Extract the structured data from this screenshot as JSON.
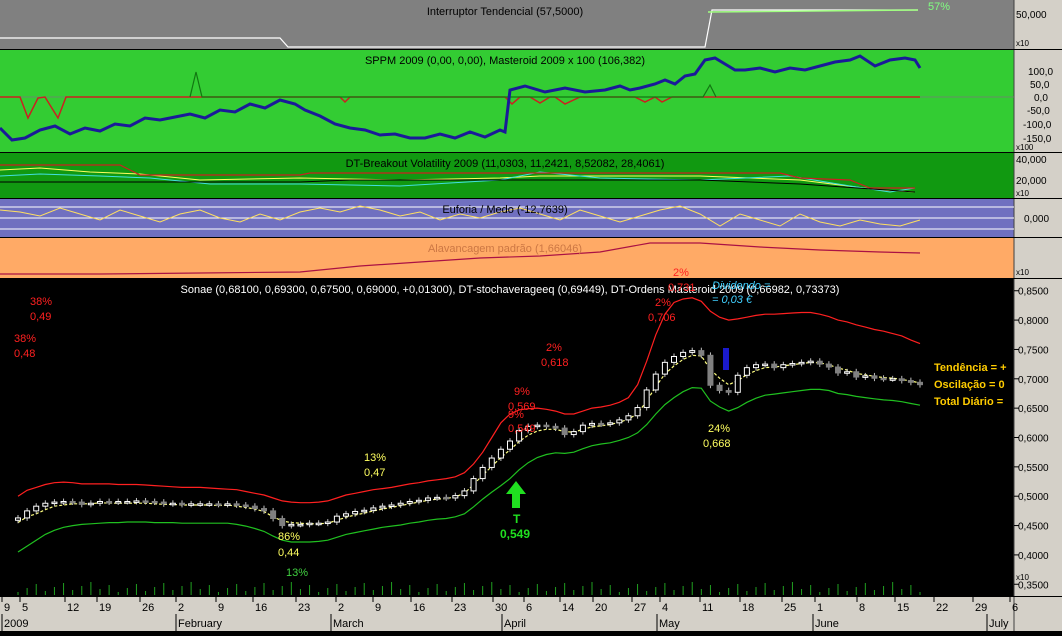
{
  "panels": {
    "switch": {
      "title": "Interruptor Tendencial (57,5000)",
      "value_label": "57%",
      "ticks": [
        "50,000"
      ],
      "scale": "x10"
    },
    "sppm": {
      "title": "SPPM 2009 (0,00, 0,00), Masteroid 2009 x 100 (106,382)",
      "ticks": [
        "100,0",
        "50,0",
        "0,0",
        "-50,0",
        "-100,0",
        "-150,0"
      ],
      "scale": "x100"
    },
    "breakout": {
      "title": "DT-Breakout Volatility 2009 (11,0303, 11,2421, 8,52082, 28,4061)",
      "ticks": [
        "40,000",
        "20,000"
      ],
      "scale": "x10"
    },
    "euforia": {
      "title": "Euforia / Medo (-12,7639)",
      "ticks": [
        "0,000"
      ]
    },
    "leverage": {
      "title": "Alavancagem padrão (1,66046)",
      "scale": "x10"
    },
    "main": {
      "title": "Sonae (0,68100, 0,69300, 0,67500, 0,69000, +0,01300), DT-stochaverageeq (0,69449), DT-Ordens Masteroid 2009 (0,66982, 0,73373)",
      "scale": "x10",
      "right_labels": [
        "Tendência = +",
        "Oscilação = 0",
        "Total Diário ="
      ]
    }
  },
  "annotations": {
    "red": [
      "38%",
      "0,49",
      "38%",
      "0,48",
      "9%",
      "0,569",
      "9%",
      "0,549",
      "2%",
      "0,618",
      "2%",
      "0,706",
      "2%",
      "0,731"
    ],
    "yellow": [
      "13%",
      "0,47",
      "86%",
      "0,44",
      "24%",
      "0,668"
    ],
    "green_pct": "13%",
    "dividend": [
      "Dividendo =",
      "= 0,03 €"
    ],
    "signal": [
      "T",
      "0,549"
    ]
  },
  "colors": {
    "candle_up": "#ffffff",
    "candle_down": "#808080",
    "upper_band": "#ff2020",
    "lower_band": "#20c020",
    "average": "#ffff80",
    "sppm_bg": "#33cc33",
    "breakout_bg": "#119911",
    "euforia_bg": "#7070c0",
    "leverage_bg": "#ffaa66",
    "switch_bg": "#808080"
  },
  "chart_data": {
    "type": "candlestick",
    "ylim": [
      0.33,
      0.87
    ],
    "y_ticks": [
      "0,8500",
      "0,8000",
      "0,7500",
      "0,7000",
      "0,6500",
      "0,6000",
      "0,5500",
      "0,5000",
      "0,4500",
      "0,4000",
      "0,3500"
    ],
    "x_day_labels": [
      "9",
      "5",
      "12",
      "19",
      "26",
      "2",
      "9",
      "16",
      "23",
      "2",
      "9",
      "16",
      "23",
      "30",
      "6",
      "14",
      "20",
      "27",
      "4",
      "11",
      "18",
      "25",
      "1",
      "8",
      "15",
      "22",
      "29",
      "6"
    ],
    "x_month_labels": [
      "2009",
      "February",
      "March",
      "April",
      "May",
      "June",
      "July"
    ],
    "close": [
      0.463,
      0.475,
      0.483,
      0.488,
      0.49,
      0.491,
      0.49,
      0.486,
      0.488,
      0.491,
      0.49,
      0.491,
      0.491,
      0.492,
      0.491,
      0.49,
      0.487,
      0.488,
      0.486,
      0.487,
      0.487,
      0.487,
      0.486,
      0.487,
      0.485,
      0.483,
      0.479,
      0.475,
      0.462,
      0.45,
      0.452,
      0.452,
      0.454,
      0.454,
      0.456,
      0.466,
      0.47,
      0.474,
      0.476,
      0.48,
      0.483,
      0.485,
      0.488,
      0.491,
      0.493,
      0.497,
      0.498,
      0.497,
      0.501,
      0.509,
      0.53,
      0.549,
      0.565,
      0.58,
      0.594,
      0.612,
      0.619,
      0.621,
      0.619,
      0.616,
      0.605,
      0.61,
      0.621,
      0.624,
      0.623,
      0.625,
      0.63,
      0.637,
      0.651,
      0.681,
      0.708,
      0.728,
      0.738,
      0.745,
      0.748,
      0.74,
      0.689,
      0.68,
      0.677,
      0.706,
      0.719,
      0.724,
      0.725,
      0.719,
      0.724,
      0.726,
      0.728,
      0.73,
      0.725,
      0.72,
      0.71,
      0.712,
      0.703,
      0.705,
      0.701,
      0.7,
      0.7,
      0.697,
      0.694,
      0.69
    ],
    "average": [
      0.455,
      0.465,
      0.47,
      0.477,
      0.483,
      0.485,
      0.487,
      0.487,
      0.487,
      0.489,
      0.488,
      0.488,
      0.488,
      0.488,
      0.488,
      0.487,
      0.486,
      0.486,
      0.485,
      0.485,
      0.485,
      0.485,
      0.484,
      0.485,
      0.483,
      0.481,
      0.478,
      0.474,
      0.465,
      0.458,
      0.455,
      0.454,
      0.453,
      0.453,
      0.454,
      0.459,
      0.464,
      0.468,
      0.471,
      0.475,
      0.478,
      0.481,
      0.484,
      0.487,
      0.49,
      0.493,
      0.495,
      0.496,
      0.499,
      0.505,
      0.52,
      0.536,
      0.551,
      0.566,
      0.579,
      0.593,
      0.604,
      0.611,
      0.614,
      0.614,
      0.61,
      0.609,
      0.614,
      0.618,
      0.62,
      0.622,
      0.626,
      0.631,
      0.641,
      0.662,
      0.687,
      0.708,
      0.722,
      0.733,
      0.74,
      0.739,
      0.716,
      0.701,
      0.69,
      0.697,
      0.707,
      0.714,
      0.719,
      0.72,
      0.722,
      0.724,
      0.726,
      0.728,
      0.727,
      0.724,
      0.718,
      0.715,
      0.709,
      0.707,
      0.704,
      0.702,
      0.701,
      0.699,
      0.696,
      0.693
    ],
    "upper_band": [
      0.5,
      0.51,
      0.515,
      0.52,
      0.523,
      0.524,
      0.523,
      0.521,
      0.521,
      0.521,
      0.521,
      0.52,
      0.52,
      0.52,
      0.519,
      0.518,
      0.517,
      0.516,
      0.515,
      0.515,
      0.515,
      0.514,
      0.513,
      0.512,
      0.511,
      0.508,
      0.505,
      0.502,
      0.497,
      0.492,
      0.49,
      0.489,
      0.489,
      0.49,
      0.492,
      0.497,
      0.502,
      0.505,
      0.508,
      0.511,
      0.513,
      0.515,
      0.518,
      0.521,
      0.523,
      0.526,
      0.528,
      0.53,
      0.533,
      0.54,
      0.555,
      0.575,
      0.6,
      0.625,
      0.64,
      0.647,
      0.649,
      0.65,
      0.648,
      0.645,
      0.64,
      0.64,
      0.645,
      0.65,
      0.652,
      0.655,
      0.66,
      0.668,
      0.69,
      0.73,
      0.775,
      0.81,
      0.83,
      0.836,
      0.838,
      0.832,
      0.815,
      0.805,
      0.8,
      0.802,
      0.805,
      0.808,
      0.81,
      0.81,
      0.811,
      0.812,
      0.813,
      0.813,
      0.81,
      0.806,
      0.8,
      0.797,
      0.792,
      0.788,
      0.784,
      0.781,
      0.777,
      0.773,
      0.766,
      0.76
    ],
    "lower_band": [
      0.405,
      0.415,
      0.425,
      0.435,
      0.442,
      0.447,
      0.45,
      0.452,
      0.453,
      0.454,
      0.455,
      0.455,
      0.456,
      0.456,
      0.456,
      0.455,
      0.455,
      0.455,
      0.454,
      0.454,
      0.454,
      0.454,
      0.454,
      0.454,
      0.452,
      0.449,
      0.445,
      0.44,
      0.432,
      0.425,
      0.422,
      0.422,
      0.422,
      0.423,
      0.425,
      0.43,
      0.435,
      0.438,
      0.441,
      0.444,
      0.447,
      0.449,
      0.451,
      0.454,
      0.456,
      0.459,
      0.461,
      0.462,
      0.465,
      0.47,
      0.482,
      0.495,
      0.507,
      0.518,
      0.53,
      0.545,
      0.557,
      0.566,
      0.571,
      0.574,
      0.573,
      0.575,
      0.581,
      0.586,
      0.589,
      0.591,
      0.595,
      0.6,
      0.608,
      0.622,
      0.64,
      0.656,
      0.668,
      0.678,
      0.685,
      0.684,
      0.662,
      0.652,
      0.645,
      0.651,
      0.66,
      0.667,
      0.672,
      0.674,
      0.676,
      0.678,
      0.68,
      0.682,
      0.682,
      0.68,
      0.675,
      0.673,
      0.67,
      0.668,
      0.666,
      0.664,
      0.663,
      0.661,
      0.658,
      0.655
    ]
  }
}
